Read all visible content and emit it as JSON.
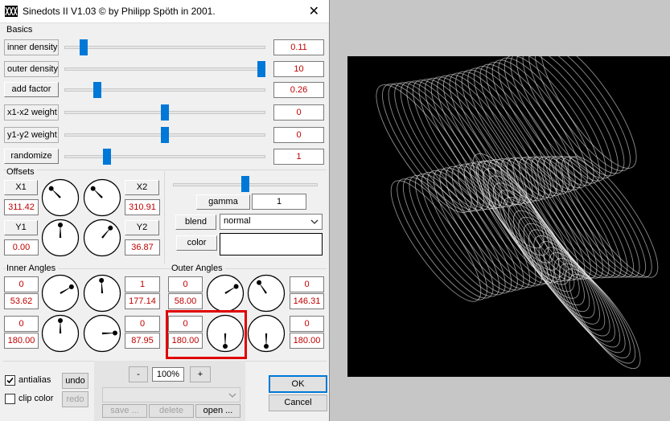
{
  "window": {
    "title": "Sinedots II V1.03 © by Philipp Spöth in 2001.",
    "close_glyph": "✕"
  },
  "basics": {
    "heading": "Basics",
    "sliders": [
      {
        "label": "inner density",
        "value": "0.11",
        "level": 0.08
      },
      {
        "label": "outer density",
        "value": "10",
        "level": 1.0
      },
      {
        "label": "add factor",
        "value": "0.26",
        "level": 0.15
      },
      {
        "label": "x1-x2 weight",
        "value": "0",
        "level": 0.5
      },
      {
        "label": "y1-y2 weight",
        "value": "0",
        "level": 0.5
      },
      {
        "label": "randomize",
        "value": "1",
        "level": 0.2
      }
    ]
  },
  "offsets": {
    "heading": "Offsets",
    "x1_label": "X1",
    "x1_value": "311.42",
    "x2_label": "X2",
    "x2_value": "310.91",
    "y1_label": "Y1",
    "y1_value": "0.00",
    "y2_label": "Y2",
    "y2_value": "36.87"
  },
  "display": {
    "gamma_level": 0.5,
    "gamma_label": "gamma",
    "gamma_value": "1",
    "blend_label": "blend",
    "blend_value": "normal",
    "color_label": "color",
    "color_swatch": "#ffffff"
  },
  "inner_angles": {
    "heading": "Inner Angles",
    "top_left_mult": "0",
    "top_left_angle": "53.62",
    "top_right_mult": "1",
    "top_right_angle": "177.14",
    "bottom_left_mult": "0",
    "bottom_left_angle": "180.00",
    "bottom_right_mult": "0",
    "bottom_right_angle": "87.95"
  },
  "outer_angles": {
    "heading": "Outer Angles",
    "top_left_mult": "0",
    "top_left_angle": "58.00",
    "top_right_mult": "0",
    "top_right_angle": "146.31",
    "bottom_left_mult": "0",
    "bottom_left_angle": "180.00",
    "bottom_right_mult": "0",
    "bottom_right_angle": "180.00"
  },
  "bottom": {
    "antialias_label": "antialias",
    "antialias_checked": true,
    "clipcolor_label": "clip color",
    "clipcolor_checked": false,
    "undo_label": "undo",
    "redo_label": "redo",
    "zoom_minus": "-",
    "zoom_value": "100%",
    "zoom_plus": "+",
    "save_label": "save ...",
    "delete_label": "delete",
    "open_label": "open ...",
    "ok_label": "OK",
    "cancel_label": "Cancel"
  },
  "colors": {
    "accent": "#0078d7",
    "value_red": "#c00000",
    "highlight": "#e00000",
    "preview_bg": "#000000"
  },
  "icons": {
    "app": "sinedots-app-icon",
    "close": "close-icon",
    "dropdown": "chevron-down-icon",
    "check": "checkmark-icon"
  }
}
